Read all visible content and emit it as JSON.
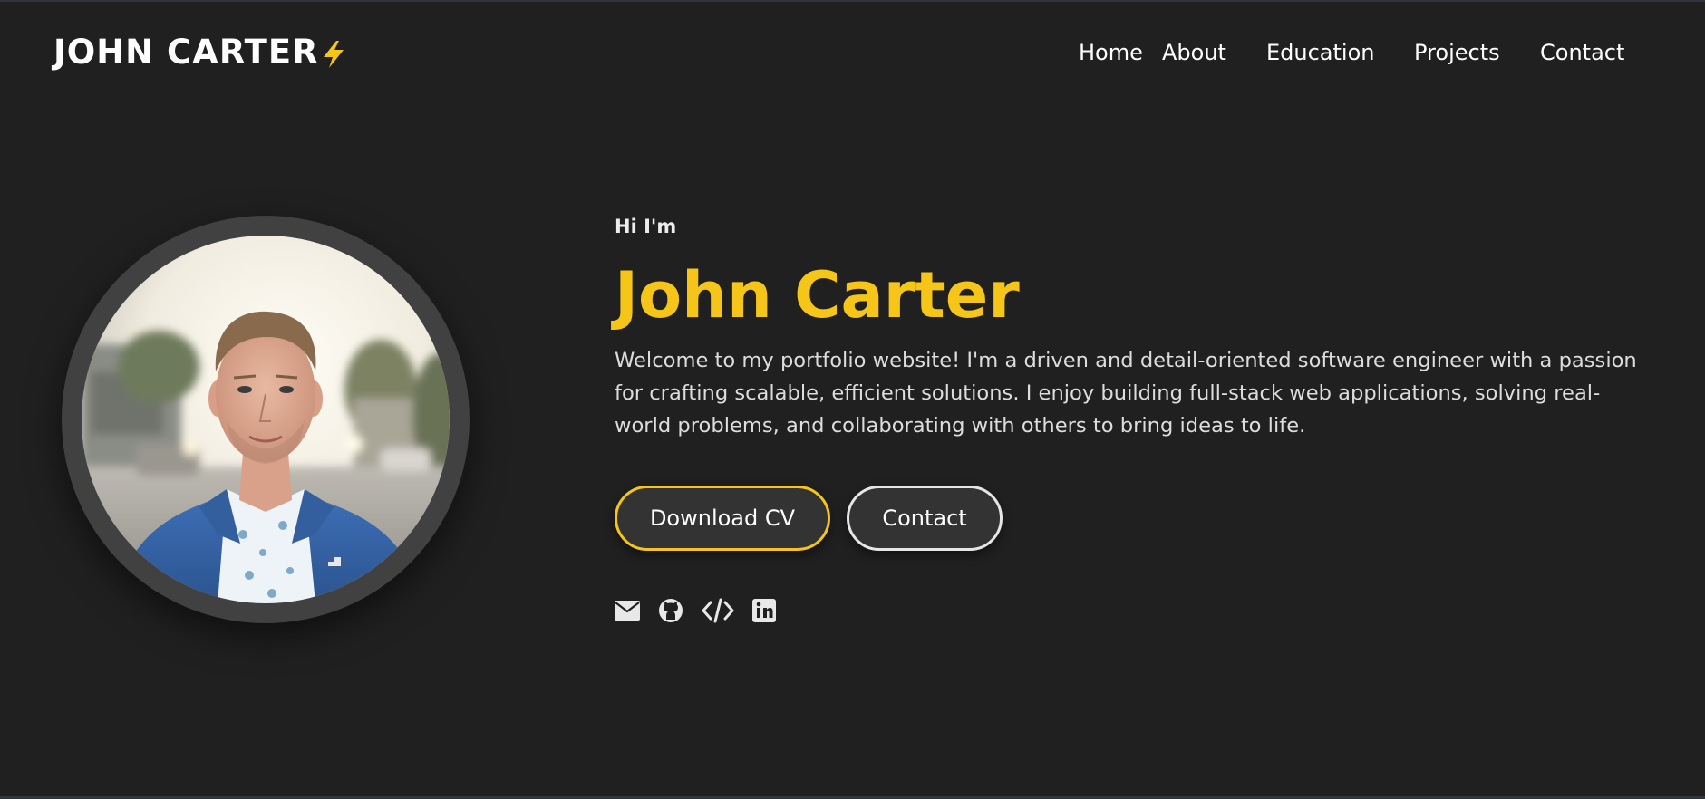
{
  "header": {
    "logo_text": "JOHN CARTER",
    "nav": [
      "Home",
      "About",
      "Education",
      "Projects",
      "Contact"
    ]
  },
  "hero": {
    "greeting": "Hi I'm",
    "name": "John Carter",
    "bio": "Welcome to my portfolio website! I'm a driven and detail-oriented software engineer with a passion for crafting scalable, efficient solutions. I enjoy building full-stack web applications, solving real-world problems, and collaborating with others to bring ideas to life.",
    "buttons": {
      "download_cv": "Download CV",
      "contact": "Contact"
    },
    "social_icons": [
      "envelope-icon",
      "github-icon",
      "code-icon",
      "linkedin-icon"
    ]
  },
  "colors": {
    "background": "#202020",
    "accent": "#f5c518",
    "text": "#ffffff",
    "button_bg": "#333333",
    "avatar_ring": "#414141"
  }
}
